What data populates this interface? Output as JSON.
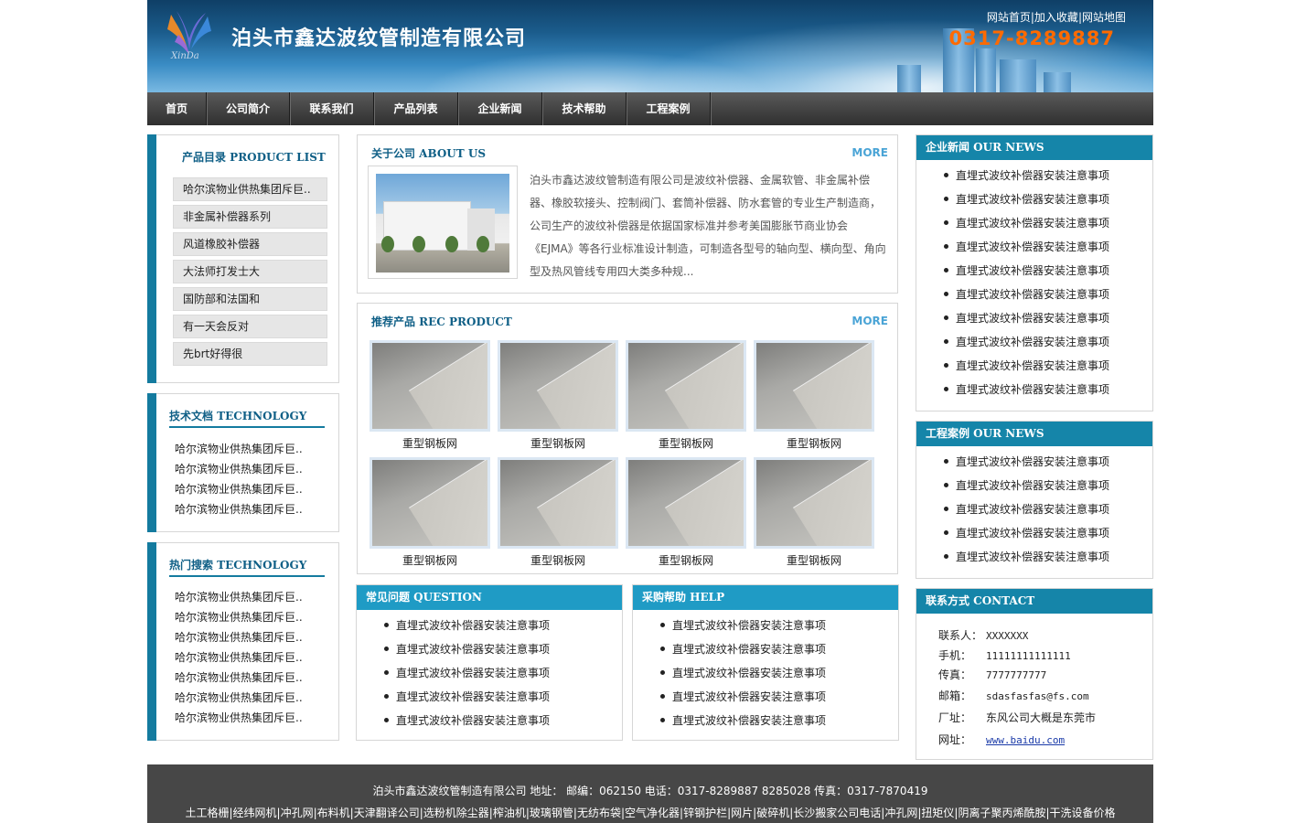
{
  "header": {
    "company": "泊头市鑫达波纹管制造有限公司",
    "logo_text": "XinDa",
    "links": [
      "网站首页",
      "加入收藏",
      "网站地图"
    ],
    "phone": "0317-8289887"
  },
  "nav": [
    "首页",
    "公司简介",
    "联系我们",
    "产品列表",
    "企业新闻",
    "技术帮助",
    "工程案例"
  ],
  "left": {
    "products": {
      "title": "产品目录 PRODUCT LIST",
      "items": [
        "哈尔滨物业供热集团斥巨..",
        "非金属补偿器系列",
        "风道橡胶补偿器",
        "大法师打发士大",
        "国防部和法国和",
        "有一天会反对",
        "先brt好得很"
      ]
    },
    "tech": {
      "title": "技术文档 TECHNOLOGY",
      "items": [
        "哈尔滨物业供热集团斥巨..",
        "哈尔滨物业供热集团斥巨..",
        "哈尔滨物业供热集团斥巨..",
        "哈尔滨物业供热集团斥巨.."
      ]
    },
    "hot": {
      "title": "热门搜索 TECHNOLOGY",
      "items": [
        "哈尔滨物业供热集团斥巨..",
        "哈尔滨物业供热集团斥巨..",
        "哈尔滨物业供热集团斥巨..",
        "哈尔滨物业供热集团斥巨..",
        "哈尔滨物业供热集团斥巨..",
        "哈尔滨物业供热集团斥巨..",
        "哈尔滨物业供热集团斥巨.."
      ]
    }
  },
  "about": {
    "title": "关于公司 ABOUT US",
    "more": "MORE",
    "lines": [
      "泊头市鑫达波纹管制造有限公司是波纹补偿器、金属软管、非金属补偿",
      "器、橡胶软接头、控制阀门、套筒补偿器、防水套管的专业生产制造商，",
      "公司生产的波纹补偿器是依据国家标准并参考美国膨胀节商业协会",
      "《EJMA》等各行业标准设计制造，可制造各型号的轴向型、横向型、角向",
      "型及热风管线专用四大类多种规..."
    ]
  },
  "rec": {
    "title": "推荐产品 REC PRODUCT",
    "more": "MORE",
    "items": [
      "重型钢板网",
      "重型钢板网",
      "重型钢板网",
      "重型钢板网",
      "重型钢板网",
      "重型钢板网",
      "重型钢板网",
      "重型钢板网"
    ]
  },
  "faq": {
    "title": "常见问题 QUESTION",
    "items": [
      "直埋式波纹补偿器安装注意事项",
      "直埋式波纹补偿器安装注意事项",
      "直埋式波纹补偿器安装注意事项",
      "直埋式波纹补偿器安装注意事项",
      "直埋式波纹补偿器安装注意事项"
    ]
  },
  "help": {
    "title": "采购帮助 HELP",
    "items": [
      "直埋式波纹补偿器安装注意事项",
      "直埋式波纹补偿器安装注意事项",
      "直埋式波纹补偿器安装注意事项",
      "直埋式波纹补偿器安装注意事项",
      "直埋式波纹补偿器安装注意事项"
    ]
  },
  "news": {
    "title": "企业新闻 OUR NEWS",
    "items": [
      "直埋式波纹补偿器安装注意事项",
      "直埋式波纹补偿器安装注意事项",
      "直埋式波纹补偿器安装注意事项",
      "直埋式波纹补偿器安装注意事项",
      "直埋式波纹补偿器安装注意事项",
      "直埋式波纹补偿器安装注意事项",
      "直埋式波纹补偿器安装注意事项",
      "直埋式波纹补偿器安装注意事项",
      "直埋式波纹补偿器安装注意事项",
      "直埋式波纹补偿器安装注意事项"
    ]
  },
  "cases": {
    "title": "工程案例 OUR NEWS",
    "items": [
      "直埋式波纹补偿器安装注意事项",
      "直埋式波纹补偿器安装注意事项",
      "直埋式波纹补偿器安装注意事项",
      "直埋式波纹补偿器安装注意事项",
      "直埋式波纹补偿器安装注意事项"
    ]
  },
  "contact": {
    "title": "联系方式 CONTACT",
    "rows": [
      {
        "k": "联系人：",
        "v": "XXXXXXX"
      },
      {
        "k": "手机：",
        "v": "11111111111111"
      },
      {
        "k": "传真：",
        "v": "7777777777"
      },
      {
        "k": "邮箱：",
        "v": "sdasfasfas@fs.com"
      },
      {
        "k": "厂址：",
        "v": "东风公司大概是东莞市"
      },
      {
        "k": "网址：",
        "v": "www.baidu.com"
      }
    ]
  },
  "footer": {
    "line1": "泊头市鑫达波纹管制造有限公司  地址：  邮编：062150  电话：0317-8289887 8285028  传真：0317-7870419",
    "links": [
      "土工格栅",
      "经纬网机",
      "冲孔网",
      "布料机",
      "天津翻译公司",
      "选粉机除尘器",
      "榨油机",
      "玻璃钢管",
      "无纺布袋",
      "空气净化器",
      "锌钢护栏",
      "网片",
      "破碎机",
      "长沙搬家公司电话",
      "冲孔网",
      "扭矩仪",
      "阴离子聚丙烯酰胺",
      "干洗设备价格"
    ]
  },
  "colors": {
    "primary": "#147b9f",
    "header_bar": "#1f9bc5",
    "phone": "#ff6a00",
    "more": "#4aa4d6",
    "footer": "#474747"
  }
}
